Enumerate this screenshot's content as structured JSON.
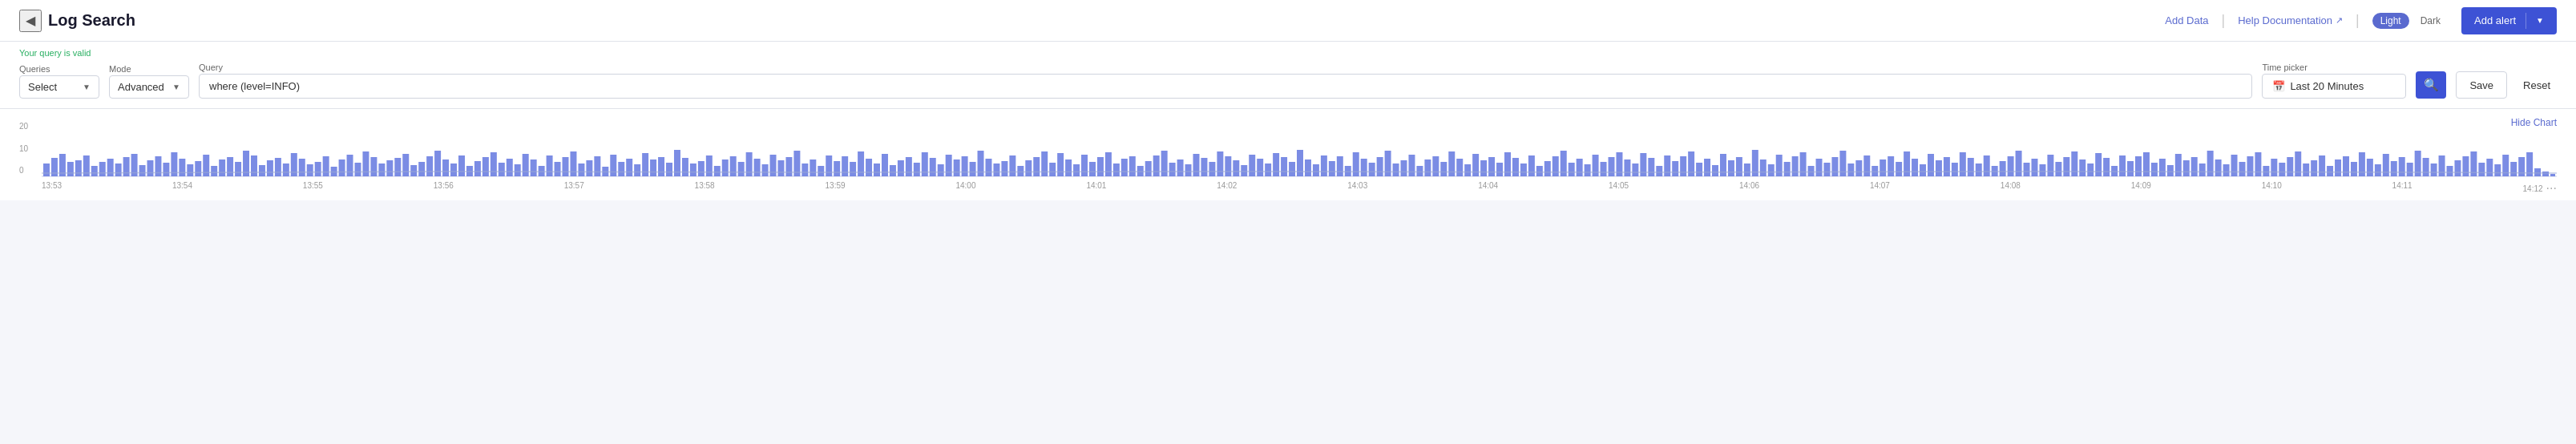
{
  "header": {
    "back_icon": "◀",
    "title": "Log Search",
    "add_data_label": "Add Data",
    "help_label": "Help Documentation",
    "external_icon": "↗",
    "theme_light": "Light",
    "theme_dark": "Dark",
    "add_alert_label": "Add alert"
  },
  "query_bar": {
    "valid_message": "Your query is valid",
    "queries_label": "Queries",
    "mode_label": "Mode",
    "query_label": "Query",
    "time_picker_label": "Time picker",
    "select_value": "Select",
    "mode_value": "Advanced",
    "query_value": "where (level=INFO)",
    "time_value": "Last 20 Minutes",
    "save_label": "Save",
    "reset_label": "Reset",
    "search_icon": "🔍"
  },
  "chart": {
    "hide_label": "Hide Chart",
    "y_labels": [
      "20",
      "10",
      "0"
    ],
    "x_labels": [
      "13:53",
      "13:54",
      "13:55",
      "13:56",
      "13:57",
      "13:58",
      "13:59",
      "14:00",
      "14:01",
      "14:02",
      "14:03",
      "14:04",
      "14:05",
      "14:06",
      "14:07",
      "14:08",
      "14:09",
      "14:10",
      "14:11",
      "14:12"
    ],
    "bar_color": "#6478e0",
    "baseline_color": "#b0b8d8"
  }
}
